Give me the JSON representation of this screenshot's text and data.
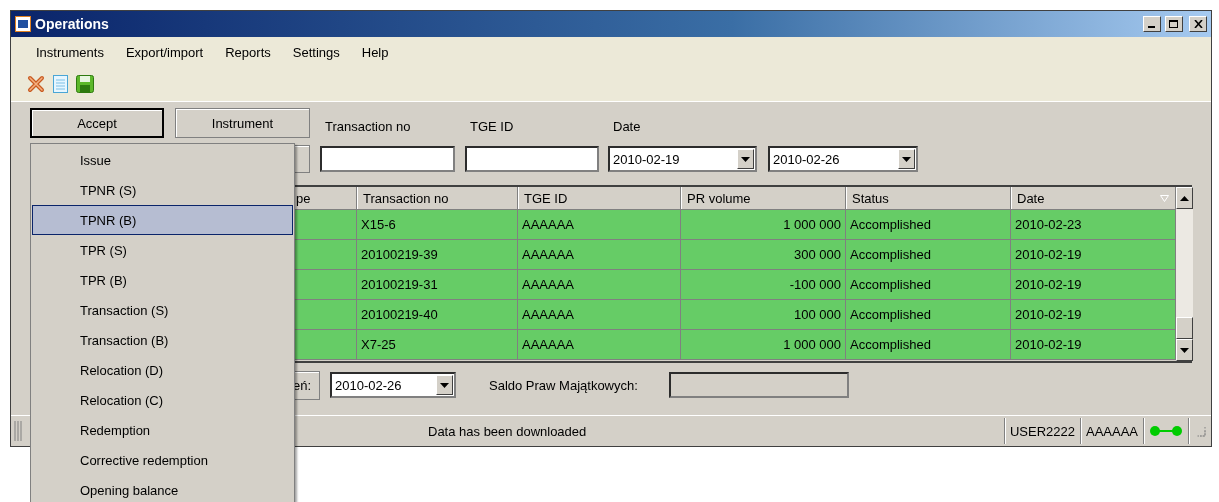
{
  "window": {
    "title": "Operations"
  },
  "menu_bar": [
    "Instruments",
    "Export/import",
    "Reports",
    "Settings",
    "Help"
  ],
  "filter_buttons": [
    {
      "label": "Accept",
      "pressed": true
    },
    {
      "label": "Instrument",
      "pressed": false
    }
  ],
  "filter_labels": {
    "transaction_no": "Transaction no",
    "tge_id": "TGE ID",
    "date": "Date"
  },
  "date_from": "2010-02-19",
  "date_to": "2010-02-26",
  "table": {
    "columns": [
      {
        "label": "pe",
        "sorted": false
      },
      {
        "label": "Transaction no",
        "sorted": false
      },
      {
        "label": "TGE ID",
        "sorted": false
      },
      {
        "label": "PR volume",
        "sorted": false
      },
      {
        "label": "Status",
        "sorted": false
      },
      {
        "label": "Date",
        "sorted": true
      }
    ],
    "rows": [
      {
        "transaction_no": "X15-6",
        "tge_id": "AAAAAA",
        "pr_volume": "1 000 000",
        "status": "Accomplished",
        "date": "2010-02-23"
      },
      {
        "transaction_no": "20100219-39",
        "tge_id": "AAAAAA",
        "pr_volume": "300 000",
        "status": "Accomplished",
        "date": "2010-02-19"
      },
      {
        "transaction_no": "20100219-31",
        "tge_id": "AAAAAA",
        "pr_volume": "-100 000",
        "status": "Accomplished",
        "date": "2010-02-19"
      },
      {
        "transaction_no": "20100219-40",
        "tge_id": "AAAAAA",
        "pr_volume": "100 000",
        "status": "Accomplished",
        "date": "2010-02-19"
      },
      {
        "transaction_no": "X7-25",
        "tge_id": "AAAAAA",
        "pr_volume": "1 000 000",
        "status": "Accomplished",
        "date": "2010-02-19"
      }
    ]
  },
  "bottom": {
    "button_label": "eń:",
    "date": "2010-02-26",
    "saldo_label": "Saldo Praw Majątkowych:"
  },
  "status_bar": {
    "message": "Data has been downloaded",
    "user": "USER2222",
    "id": "AAAAAA",
    "connected": true
  },
  "dropdown_menu": {
    "items": [
      {
        "label": "Issue",
        "selected": false
      },
      {
        "label": "TPNR (S)",
        "selected": false
      },
      {
        "label": "TPNR (B)",
        "selected": true
      },
      {
        "label": "TPR (S)",
        "selected": false
      },
      {
        "label": "TPR (B)",
        "selected": false
      },
      {
        "label": "Transaction (S)",
        "selected": false
      },
      {
        "label": "Transaction (B)",
        "selected": false
      },
      {
        "label": "Relocation (D)",
        "selected": false
      },
      {
        "label": "Relocation (C)",
        "selected": false
      },
      {
        "label": "Redemption",
        "selected": false
      },
      {
        "label": "Corrective redemption",
        "selected": false
      },
      {
        "label": "Opening balance",
        "selected": false
      }
    ]
  }
}
